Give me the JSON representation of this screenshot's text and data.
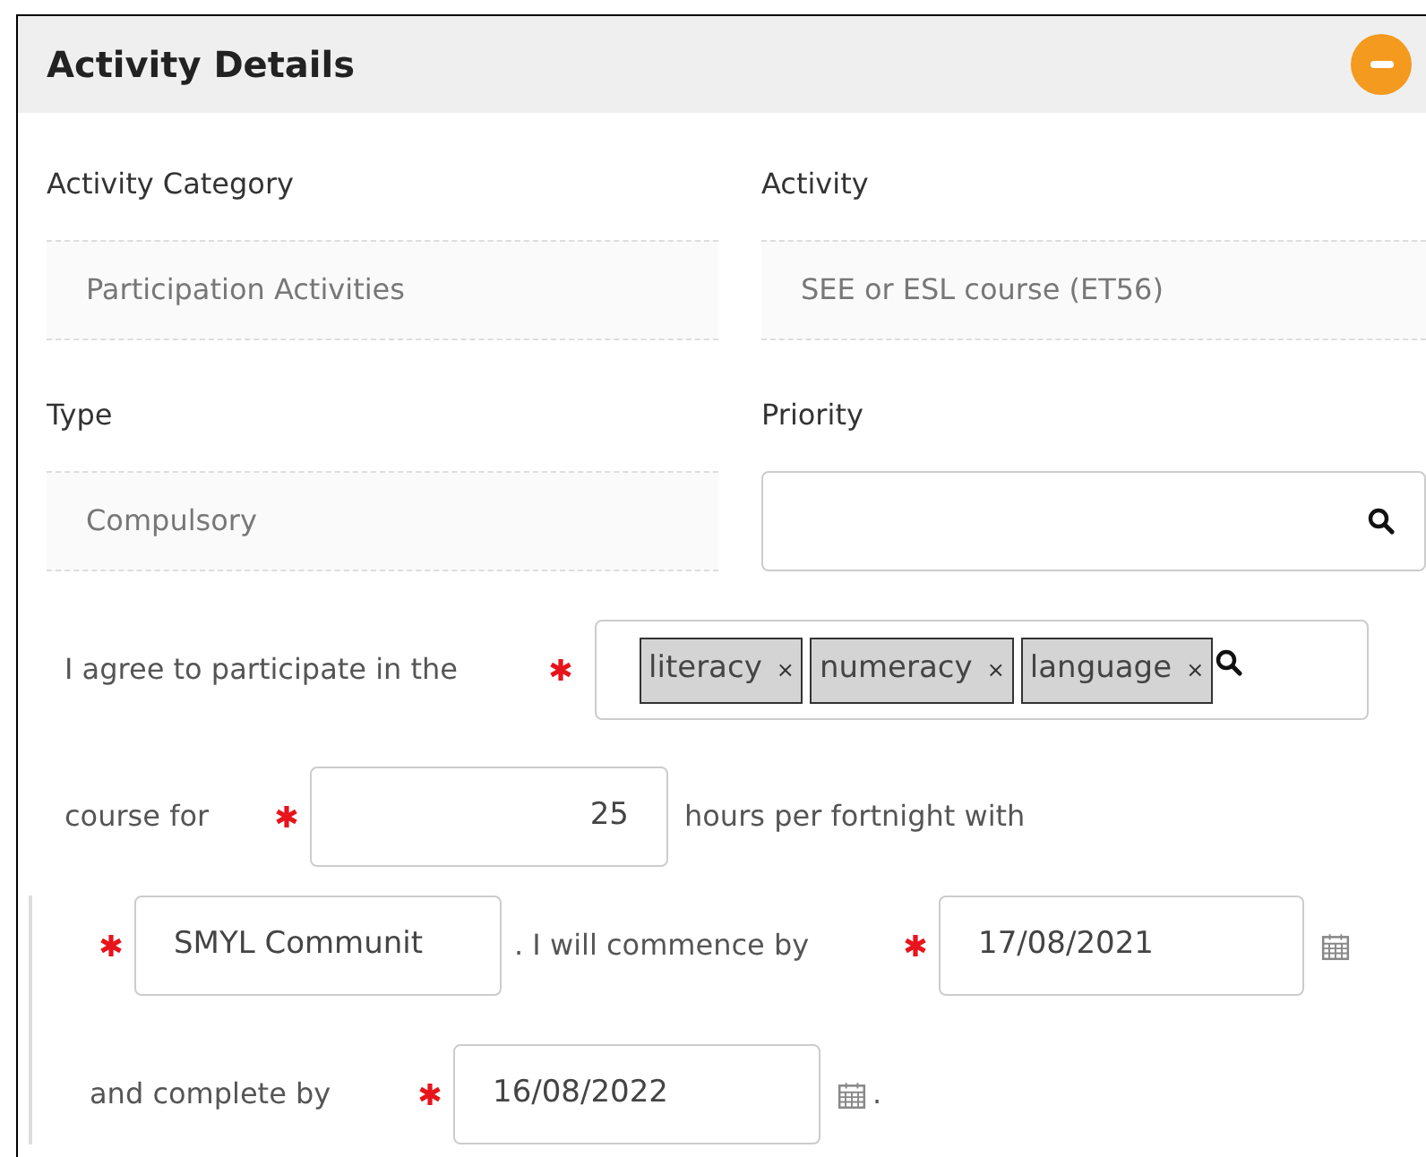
{
  "panel": {
    "title": "Activity Details",
    "expanded": true
  },
  "fields": [
    {
      "label": "Activity Category",
      "value": "Participation Activities",
      "kind": "readonly"
    },
    {
      "label": "Activity",
      "value": "SEE or ESL course (ET56)",
      "kind": "readonly"
    },
    {
      "label": "Type",
      "value": "Compulsory",
      "kind": "readonly"
    },
    {
      "label": "Priority",
      "kind": "search"
    }
  ],
  "agreement": {
    "intro": "I agree to participate in the",
    "intro_required": true,
    "tags": [
      {
        "label": "literacy",
        "remove": "×"
      },
      {
        "label": "numeracy",
        "remove": "×"
      },
      {
        "label": "language",
        "remove": "×"
      }
    ],
    "course_for": "course for",
    "hours_required": true,
    "hours": "25",
    "hours_text": "hours per fortnight with",
    "provider_required": true,
    "provider": "SMYL Communit",
    "commence_text": ". I will commence by",
    "commence_required": true,
    "commence_date": "17/08/2021",
    "complete_text": "and complete by",
    "complete_required": true,
    "complete_date": "16/08/2022",
    "end_text": "."
  }
}
